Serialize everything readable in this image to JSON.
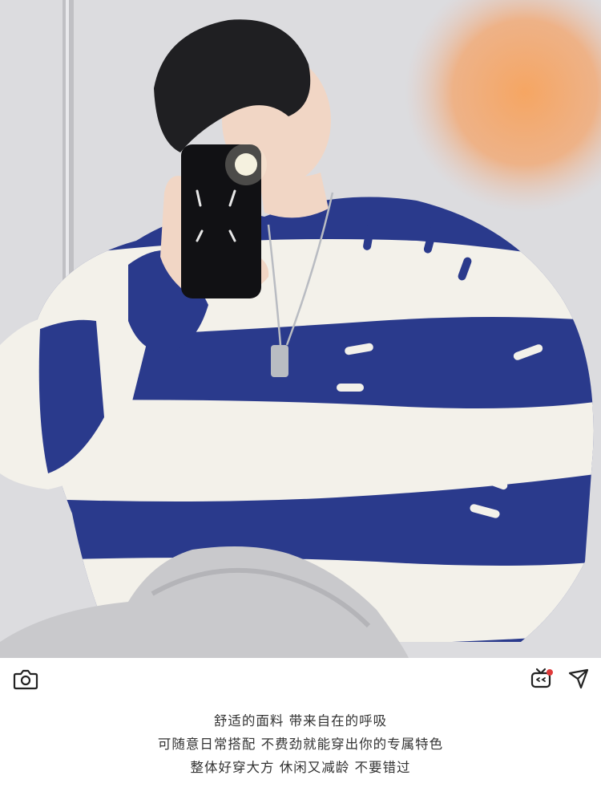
{
  "photo": {
    "subject": "product-photo-striped-fuzzy-sweater",
    "colors": {
      "stripe_blue": "#2a3a8c",
      "stripe_white": "#f3f1ea",
      "sunset_glow": "#f7a35c",
      "pants_gray": "#c9c9cc"
    }
  },
  "toolbar": {
    "left_icon": "camera-icon",
    "right_icons": [
      "tv-icon",
      "send-icon"
    ],
    "accent_color": "#e03a3a"
  },
  "caption": {
    "lines": [
      "舒适的面料 带来自在的呼吸",
      "可随意日常搭配 不费劲就能穿出你的专属特色",
      "整体好穿大方 休闲又减龄 不要错过"
    ]
  }
}
